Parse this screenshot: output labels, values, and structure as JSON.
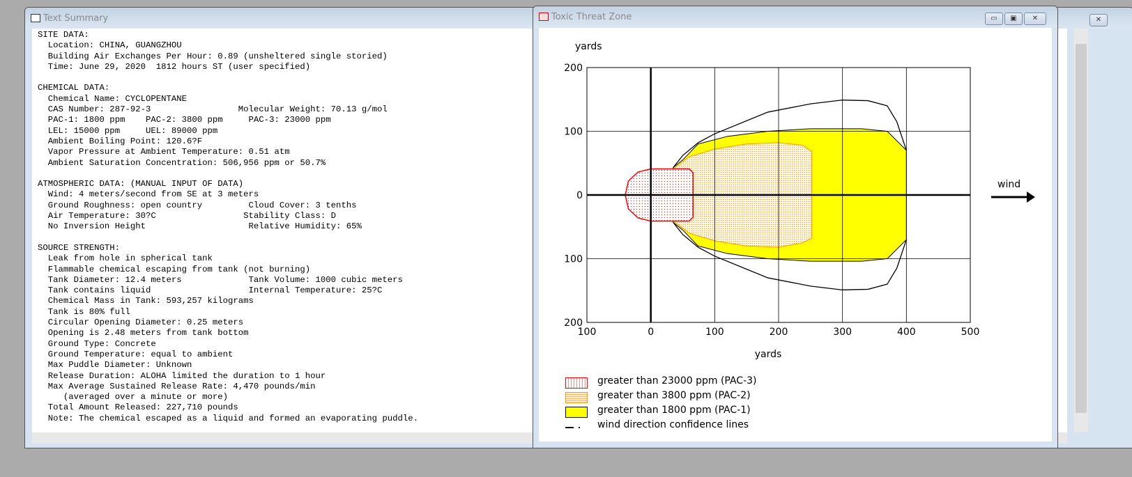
{
  "text_summary": {
    "title": "Text Summary",
    "lines": [
      "SITE DATA:",
      "  Location: CHINA, GUANGZHOU",
      "  Building Air Exchanges Per Hour: 0.89 (unsheltered single storied)",
      "  Time: June 29, 2020  1812 hours ST (user specified)",
      "",
      "CHEMICAL DATA:",
      "  Chemical Name: CYCLOPENTANE",
      "  CAS Number: 287-92-3                 Molecular Weight: 70.13 g/mol",
      "  PAC-1: 1800 ppm    PAC-2: 3800 ppm     PAC-3: 23000 ppm",
      "  LEL: 15000 ppm     UEL: 89000 ppm",
      "  Ambient Boiling Point: 120.6?F",
      "  Vapor Pressure at Ambient Temperature: 0.51 atm",
      "  Ambient Saturation Concentration: 506,956 ppm or 50.7%",
      "",
      "ATMOSPHERIC DATA: (MANUAL INPUT OF DATA)",
      "  Wind: 4 meters/second from SE at 3 meters",
      "  Ground Roughness: open country         Cloud Cover: 3 tenths",
      "  Air Temperature: 30?C                 Stability Class: D",
      "  No Inversion Height                    Relative Humidity: 65%",
      "",
      "SOURCE STRENGTH:",
      "  Leak from hole in spherical tank",
      "  Flammable chemical escaping from tank (not burning)",
      "  Tank Diameter: 12.4 meters             Tank Volume: 1000 cubic meters",
      "  Tank contains liquid                   Internal Temperature: 25?C",
      "  Chemical Mass in Tank: 593,257 kilograms",
      "  Tank is 80% full",
      "  Circular Opening Diameter: 0.25 meters",
      "  Opening is 2.48 meters from tank bottom",
      "  Ground Type: Concrete",
      "  Ground Temperature: equal to ambient",
      "  Max Puddle Diameter: Unknown",
      "  Release Duration: ALOHA limited the duration to 1 hour",
      "  Max Average Sustained Release Rate: 4,470 pounds/min",
      "     (averaged over a minute or more)",
      "  Total Amount Released: 227,710 pounds",
      "  Note: The chemical escaped as a liquid and formed an evaporating puddle."
    ]
  },
  "threat_zone": {
    "title": "Toxic Threat Zone",
    "buttons": {
      "minimize": "▭",
      "restore": "▣",
      "close": "✕"
    },
    "wind_label": "wind",
    "legend": [
      {
        "label": "greater than 23000 ppm (PAC-3)",
        "color": "#ff0000"
      },
      {
        "label": "greater than 3800 ppm (PAC-2)",
        "color": "#ff9900"
      },
      {
        "label": "greater than 1800 ppm (PAC-1)",
        "color": "#ffff00"
      },
      {
        "label": "wind direction confidence lines",
        "color": "#000000"
      }
    ]
  },
  "chart_data": {
    "type": "area",
    "xlabel": "yards",
    "ylabel": "yards",
    "xlim": [
      -100,
      500
    ],
    "ylim": [
      -200,
      200
    ],
    "x_ticks": [
      "100",
      "0",
      "100",
      "200",
      "300",
      "400",
      "500"
    ],
    "y_ticks": [
      "200",
      "100",
      "0",
      "100",
      "200"
    ],
    "grid": true,
    "zones": [
      {
        "name": "PAC-1",
        "color": "#ffff00",
        "outline": "#000000",
        "points": [
          [
            35,
            43
          ],
          [
            50,
            55
          ],
          [
            74,
            80
          ],
          [
            120,
            92
          ],
          [
            183,
            100
          ],
          [
            250,
            104
          ],
          [
            330,
            104
          ],
          [
            370,
            100
          ],
          [
            400,
            70
          ],
          [
            400,
            -70
          ],
          [
            370,
            -100
          ],
          [
            330,
            -104
          ],
          [
            250,
            -104
          ],
          [
            183,
            -100
          ],
          [
            120,
            -92
          ],
          [
            74,
            -80
          ],
          [
            50,
            -55
          ],
          [
            35,
            -43
          ]
        ]
      },
      {
        "name": "PAC-2",
        "color": "#ff9900",
        "points": [
          [
            34,
            40
          ],
          [
            60,
            60
          ],
          [
            100,
            72
          ],
          [
            150,
            80
          ],
          [
            200,
            82
          ],
          [
            238,
            78
          ],
          [
            252,
            68
          ],
          [
            252,
            -68
          ],
          [
            238,
            -75
          ],
          [
            200,
            -82
          ],
          [
            150,
            -80
          ],
          [
            100,
            -72
          ],
          [
            60,
            -60
          ],
          [
            34,
            -40
          ]
        ]
      },
      {
        "name": "PAC-3",
        "color": "#ff0000",
        "points": [
          [
            66,
            35
          ],
          [
            60,
            41
          ],
          [
            0,
            41
          ],
          [
            -20,
            36
          ],
          [
            -35,
            22
          ],
          [
            -40,
            0
          ],
          [
            -35,
            -22
          ],
          [
            -20,
            -36
          ],
          [
            0,
            -41
          ],
          [
            60,
            -41
          ],
          [
            66,
            -35
          ]
        ]
      }
    ],
    "confidence_lines": [
      [
        [
          35,
          43
        ],
        [
          50,
          62
        ],
        [
          74,
          82
        ],
        [
          100,
          96
        ],
        [
          183,
          130
        ],
        [
          250,
          143
        ],
        [
          300,
          149
        ],
        [
          340,
          148
        ],
        [
          370,
          140
        ],
        [
          385,
          115
        ],
        [
          400,
          70
        ]
      ],
      [
        [
          35,
          -43
        ],
        [
          50,
          -62
        ],
        [
          74,
          -82
        ],
        [
          100,
          -96
        ],
        [
          183,
          -130
        ],
        [
          250,
          -143
        ],
        [
          300,
          -149
        ],
        [
          340,
          -148
        ],
        [
          370,
          -140
        ],
        [
          385,
          -115
        ],
        [
          400,
          -70
        ]
      ]
    ]
  }
}
